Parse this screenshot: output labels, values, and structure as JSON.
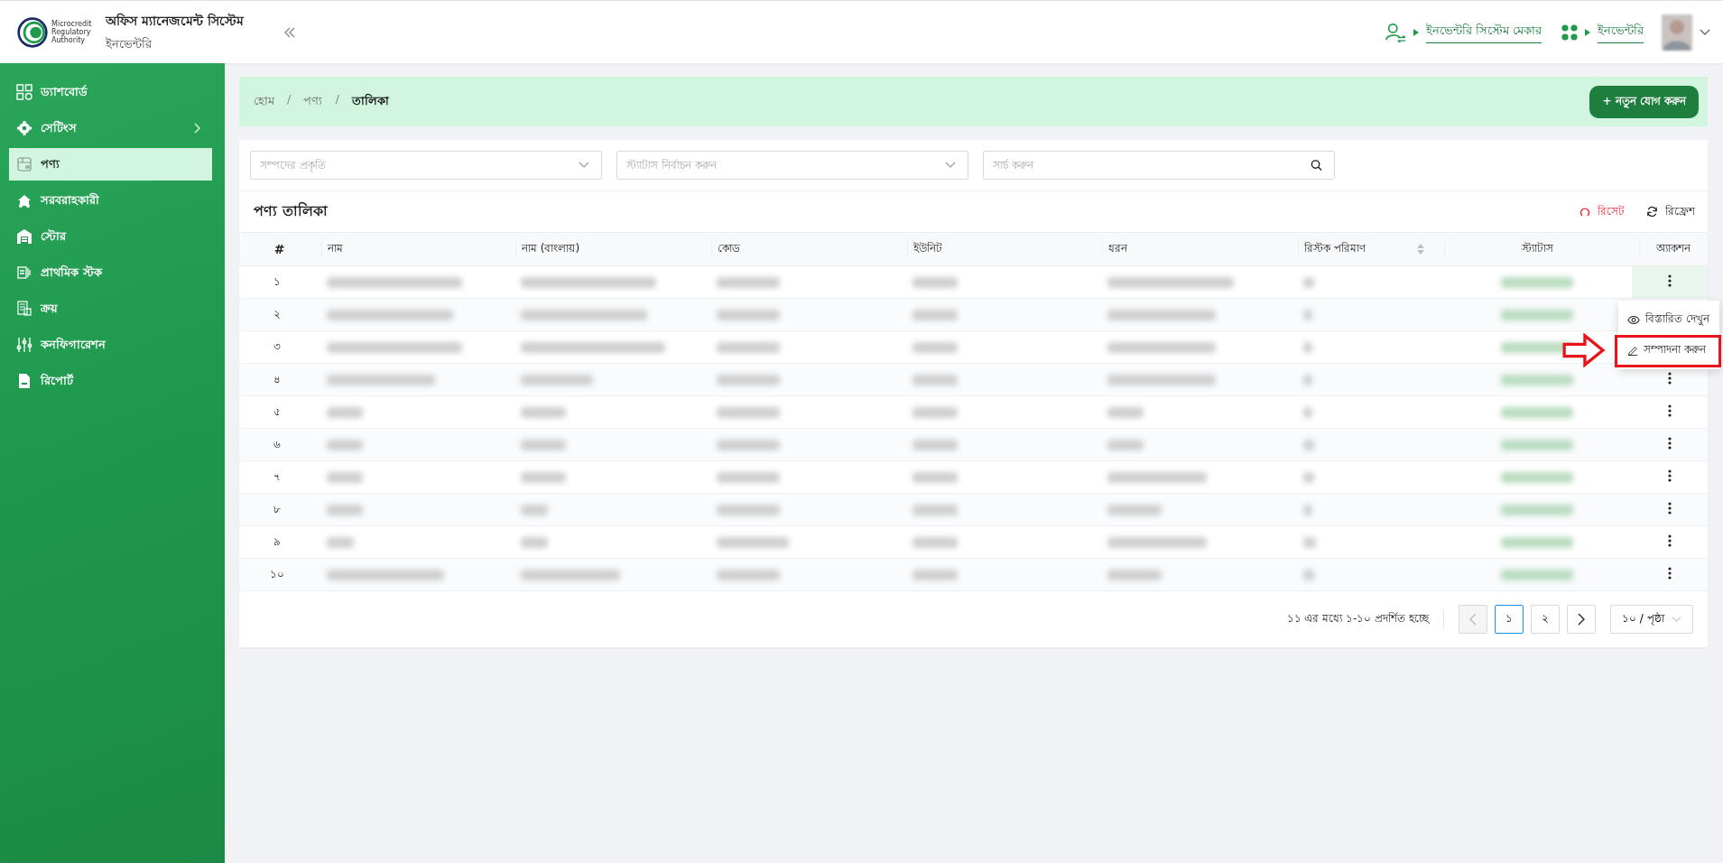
{
  "header": {
    "logo_text": [
      "Microcredit",
      "Regulatory",
      "Authority"
    ],
    "app_title": "অফিস ম্যানেজমেন্ট সিস্টেম",
    "app_subtitle": "ইনভেন্টরি",
    "role_link": "ইনভেন্টরি সিস্টেম মেকার",
    "module_link": "ইনভেন্টরি"
  },
  "sidebar": {
    "items": [
      {
        "label": "ড্যাশবোর্ড",
        "selected": false,
        "has_children": false
      },
      {
        "label": "সেটিংস",
        "selected": false,
        "has_children": true
      },
      {
        "label": "পণ্য",
        "selected": true,
        "has_children": false
      },
      {
        "label": "সরবরাহকারী",
        "selected": false,
        "has_children": false
      },
      {
        "label": "স্টোর",
        "selected": false,
        "has_children": false
      },
      {
        "label": "প্রাথমিক স্টক",
        "selected": false,
        "has_children": false
      },
      {
        "label": "ক্রয়",
        "selected": false,
        "has_children": false
      },
      {
        "label": "কনফিগারেশন",
        "selected": false,
        "has_children": false
      },
      {
        "label": "রিপোর্ট",
        "selected": false,
        "has_children": false
      }
    ]
  },
  "breadcrumb": [
    {
      "kind": "link",
      "label": "হোম"
    },
    {
      "kind": "separator",
      "label": "/"
    },
    {
      "kind": "link",
      "label": "পণ্য"
    },
    {
      "kind": "separator",
      "label": "/"
    },
    {
      "kind": "current",
      "label": "তালিকা"
    }
  ],
  "add_button": "+ নতুন যোগ করুন",
  "filters": [
    {
      "kind": "select",
      "placeholder": "সম্পদের প্রকৃতি"
    },
    {
      "kind": "select",
      "placeholder": "স্ট্যাটাস নির্বাচন করুন"
    },
    {
      "kind": "search",
      "placeholder": "সার্চ করুন"
    }
  ],
  "table": {
    "title": "পণ্য তালিকা",
    "reset": "রিসেট",
    "refresh": "রিফ্রেশ",
    "columns": [
      {
        "label": "#",
        "sortable": false
      },
      {
        "label": "নাম",
        "sortable": false
      },
      {
        "label": "নাম (বাংলায়)",
        "sortable": false
      },
      {
        "label": "কোড",
        "sortable": false
      },
      {
        "label": "ইউনিট",
        "sortable": false
      },
      {
        "label": "ধরন",
        "sortable": false
      },
      {
        "label": "রিস্টক পরিমাণ",
        "sortable": true
      },
      {
        "label": "স্ট্যাটাস",
        "sortable": false
      },
      {
        "label": "অ্যাকশন",
        "sortable": false
      }
    ],
    "rows": [
      {
        "number": "১",
        "menu_open": true
      },
      {
        "number": "২",
        "menu_open": false
      },
      {
        "number": "৩",
        "menu_open": false
      },
      {
        "number": "৪",
        "menu_open": false
      },
      {
        "number": "৫",
        "menu_open": false
      },
      {
        "number": "৬",
        "menu_open": false
      },
      {
        "number": "৭",
        "menu_open": false
      },
      {
        "number": "৮",
        "menu_open": false
      },
      {
        "number": "৯",
        "menu_open": false
      },
      {
        "number": "১০",
        "menu_open": false
      }
    ]
  },
  "row_menu": {
    "items": [
      {
        "label": "বিস্তারিত দেখুন",
        "highlighted": false
      },
      {
        "label": "সম্পাদনা করুন",
        "highlighted": true
      }
    ]
  },
  "pagination": {
    "summary": "১১ এর মধ্যে ১-১০ প্রদর্শিত হচ্ছে",
    "prev_disabled": true,
    "next_disabled": false,
    "pages": [
      {
        "label": "১",
        "selected": true
      },
      {
        "label": "২",
        "selected": false
      }
    ],
    "page_size": "১০ / পৃষ্ঠা"
  }
}
